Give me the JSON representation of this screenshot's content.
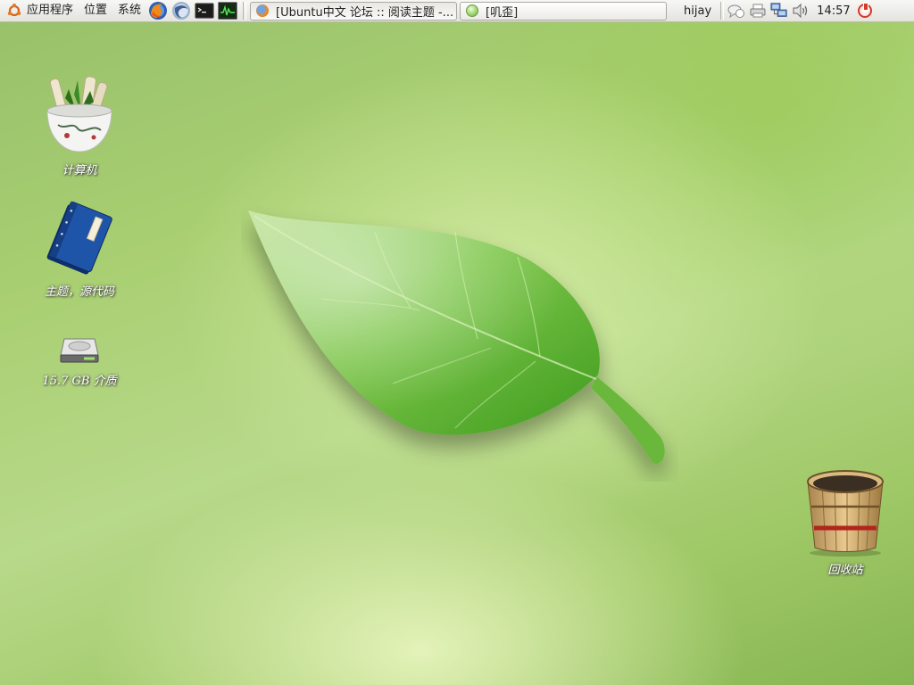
{
  "panel": {
    "menus": {
      "applications": "应用程序",
      "places": "位置",
      "system": "系统"
    },
    "launchers": [
      {
        "name": "firefox-icon"
      },
      {
        "name": "thunderbird-icon"
      },
      {
        "name": "terminal-icon"
      },
      {
        "name": "system-monitor-icon"
      }
    ],
    "tasks": [
      {
        "label": "[Ubuntu中文 论坛 :: 阅读主题 -...",
        "icon": "firefox-icon"
      },
      {
        "label": "[叽歪]",
        "icon": "pidgin-icon"
      }
    ],
    "username": "hijay",
    "clock": "14:57",
    "tray_icons": [
      "chat-bubble-icon",
      "printer-icon",
      "network-icon",
      "volume-icon"
    ]
  },
  "desktop": {
    "icons": [
      {
        "label": "计算机",
        "icon": "computer-icon"
      },
      {
        "label": "主题，源代码",
        "icon": "book-folder-icon"
      },
      {
        "label": "15.7 GB 介质",
        "icon": "drive-icon"
      },
      {
        "label": "回收站",
        "icon": "trash-bucket-icon"
      }
    ]
  },
  "colors": {
    "wallpaper": "#a9cf72",
    "leaf": "#5cb82e",
    "panel": "#eeede8"
  }
}
